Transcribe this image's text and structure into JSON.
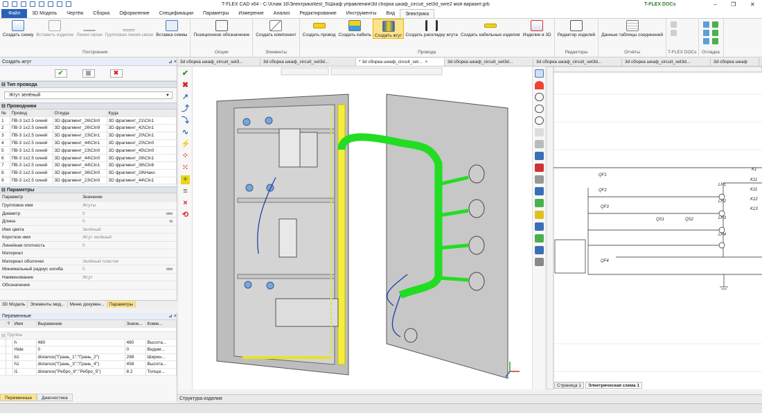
{
  "app": {
    "title": "T-FLEX CAD x64 - C:\\Хлам 16\\Электрика\\test_5\\Шкаф управления\\3d сборка шкаф_circuit_set3d_wire2 мой вариант.grb",
    "docs_label": "T-FLEX DOCs"
  },
  "menu": {
    "tabs": [
      "Файл",
      "3D Модель",
      "Чертёж",
      "Сборка",
      "Оформление",
      "Спецификации",
      "Параметры",
      "Измерение",
      "Анализ",
      "Редактирование",
      "Инструменты",
      "Вид",
      "Электрика"
    ]
  },
  "ribbon": {
    "groups": [
      {
        "name": "Построения",
        "buttons": [
          "Создать схему",
          "Вставить изделие",
          "Линия связи",
          "Групповая линия связи",
          "Вставка схемы"
        ]
      },
      {
        "name": "Опции",
        "buttons": [
          "Позиционное обозначение"
        ]
      },
      {
        "name": "Элементы",
        "buttons": [
          "Создать компонент"
        ]
      },
      {
        "name": "Провода",
        "buttons": [
          "Создать провод",
          "Создать кабель",
          "Создать жгут",
          "Создать раскладку жгута",
          "Создать кабельные изделия",
          "Изделие в 3D"
        ]
      },
      {
        "name": "Редакторы",
        "buttons": [
          "Редактор изделий"
        ]
      },
      {
        "name": "Отчёты",
        "buttons": [
          "Данные таблицы соединений"
        ]
      },
      {
        "name": "T-FLEX DOCs",
        "buttons": []
      },
      {
        "name": "Отладка",
        "buttons": []
      }
    ]
  },
  "left_panel": {
    "title": "Создать жгут",
    "wire_type_header": "Тип провода",
    "wire_type_value": "Жгут зелёный",
    "conductors_header": "Проводники",
    "conductor_columns": [
      "№",
      "Провод",
      "Откуда",
      "Куда"
    ],
    "conductors": [
      [
        "1",
        "ПВ-3 1х2.5 синий",
        "3D фрагмент_26\\Cln0",
        "3D фрагмент_21\\Cln1"
      ],
      [
        "2",
        "ПВ-3 1х2.5 синий",
        "3D фрагмент_26\\Cln9",
        "3D фрагмент_42\\Cln1"
      ],
      [
        "3",
        "ПВ-3 1х2.5 синий",
        "3D фрагмент_23\\Cln1",
        "3D фрагмент_20\\Cln1"
      ],
      [
        "4",
        "ПВ-3 1х2.5 синий",
        "3D фрагмент_44\\Cln1",
        "3D фрагмент_20\\Cln0"
      ],
      [
        "5",
        "ПВ-3 1х2.5 синий",
        "3D фрагмент_23\\Cln0",
        "3D фрагмент_45\\Cln0"
      ],
      [
        "6",
        "ПВ-3 1х2.5 синий",
        "3D фрагмент_44\\Cln0",
        "3D фрагмент_26\\Cln1"
      ],
      [
        "7",
        "ПВ-3 1х2.5 синий",
        "3D фрагмент_44\\Cln1",
        "3D фрагмент_36\\Cln6"
      ],
      [
        "8",
        "ПВ-3 1х2.5 синий",
        "3D фрагмент_36\\Cln0",
        "3D фрагмент_28\\Нако"
      ],
      [
        "9",
        "ПВ-3 1х2.5 синий",
        "3D фрагмент_23\\Cln0",
        "3D фрагмент_44\\Cln1"
      ]
    ],
    "params_header": "Параметры",
    "param_columns": [
      "Параметр",
      "Значение"
    ],
    "params": [
      [
        "Групповое имя",
        "Жгуты",
        ""
      ],
      [
        "Диаметр",
        "0",
        "мм"
      ],
      [
        "Длина",
        "0",
        "м"
      ],
      [
        "Имя цвета",
        "Зелёный",
        ""
      ],
      [
        "Короткое имя",
        "Жгут зелёный",
        ""
      ],
      [
        "Линейная плотность",
        "0",
        ""
      ],
      [
        "Материал",
        "",
        ""
      ],
      [
        "Материал оболочки",
        "Зелёный пластик",
        ""
      ],
      [
        "Минимальный радиус изгиба",
        "0",
        "мм"
      ],
      [
        "Наименование",
        "Жгут",
        ""
      ],
      [
        "Обозначение",
        "",
        ""
      ]
    ],
    "tabs": [
      "3D Модель",
      "Элементы мод...",
      "Меню докумен...",
      "Параметры"
    ]
  },
  "variables_panel": {
    "title": "Переменные",
    "columns": [
      "",
      "?",
      "Имя",
      "Выражение",
      "Значе...",
      "Комм..."
    ],
    "group_label": "Группы",
    "rows": [
      [
        "",
        "",
        "h",
        "480",
        "480",
        "Высота..."
      ],
      [
        "",
        "",
        "Hide",
        "0",
        "0",
        "Видим..."
      ],
      [
        "",
        "",
        "b1",
        "distance(\"Грань_1\";\"Грань_2\")",
        "298",
        "Ширин..."
      ],
      [
        "",
        "",
        "h1",
        "distance(\"Грань_3\";\"Грань_4\")",
        "458",
        "Высота..."
      ],
      [
        "",
        "",
        "l1",
        "distance(\"Ребро_6\";\"Ребро_5\")",
        "8.2",
        "Толщи..."
      ]
    ],
    "tabs": [
      "Переменные",
      "Диагностика"
    ]
  },
  "doc_tabs": [
    "3d сборка шкаф_circuit_set3...",
    "3d сборка шкаф_circuit_set3d...",
    "* 3d сборка шкаф_circuit_set...",
    "3d сборка шкаф_circuit_set3d...",
    "3d сборка шкаф_circuit_set3d...",
    "3d сборка шкаф_circuit_set3d...",
    "3d сборка шкаф"
  ],
  "schematic": {
    "labels": [
      "QF1",
      "QF2",
      "QF3",
      "QF4",
      "QS1",
      "QS2",
      "LH1",
      "LH2",
      "LH3",
      "LH4",
      "K1",
      "K11",
      "K11",
      "K12",
      "K13"
    ],
    "page_tabs": [
      "Страница 1",
      "Электрическая схема 1"
    ]
  },
  "structure_panel": {
    "title": "Структура изделия"
  },
  "colors": {
    "accent": "#2a61b8",
    "harness": "#22dd22",
    "wire": "#1f3fa8",
    "highlight": "#fde38c"
  }
}
